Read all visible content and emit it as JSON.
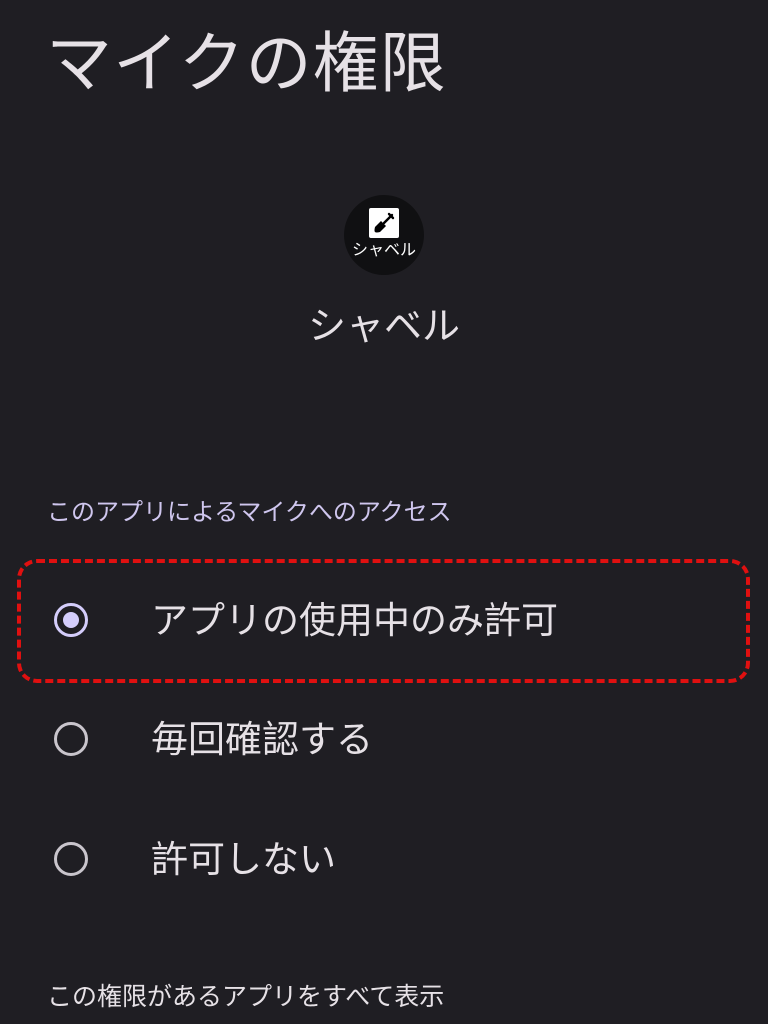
{
  "header": {
    "title": "マイクの権限"
  },
  "app": {
    "icon": "shovel-icon",
    "icon_label": "シャベル",
    "name": "シャベル"
  },
  "access": {
    "section_label": "このアプリによるマイクへのアクセス",
    "options": [
      {
        "label": "アプリの使用中のみ許可",
        "selected": true
      },
      {
        "label": "毎回確認する",
        "selected": false
      },
      {
        "label": "許可しない",
        "selected": false
      }
    ]
  },
  "footer": {
    "link_label": "この権限があるアプリをすべて表示"
  },
  "colors": {
    "background": "#1f1e23",
    "accent": "#d4cdfb",
    "highlight": "#e01010"
  }
}
